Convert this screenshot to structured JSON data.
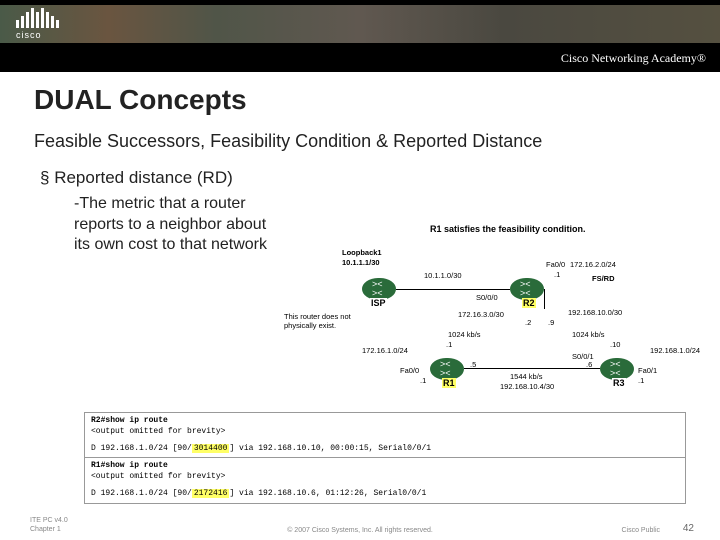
{
  "header": {
    "brand": "cisco",
    "academy": "Cisco Networking Academy®"
  },
  "slide": {
    "title": "DUAL Concepts",
    "subtitle": "Feasible Successors, Feasibility Condition & Reported Distance",
    "bullet": "Reported distance (RD)",
    "subbullet": "-The metric that a router reports to a neighbor about its own cost to that network"
  },
  "diagram": {
    "caption": "R1 satisfies the feasibility condition.",
    "loopback_title": "Loopback1",
    "loopback_ip": "10.1.1.1/30",
    "note": "This router does not physically exist.",
    "routers": {
      "isp": "ISP",
      "r1": "R1",
      "r2": "R2",
      "r3": "R3"
    },
    "nets": {
      "n1": "10.1.1.0/30",
      "n2": "172.16.1.0/24",
      "n3": "172.16.3.0/30",
      "n4": "172.16.2.0/24",
      "n5": "192.168.10.0/30",
      "n6": "192.168.10.4/30",
      "n7": "192.168.1.0/24"
    },
    "ports": {
      "fa00": "Fa0/0",
      "fa01": "Fa0/1",
      "s000": "S0/0/0",
      "s001": "S0/0/1"
    },
    "speeds": {
      "k1024": "1024 kb/s",
      "k1544": "1544 kb/s"
    },
    "dots": {
      "d1": ".1",
      "d2": ".2",
      "d5": ".5",
      "d6": ".6",
      "d9": ".9",
      "d10": ".10"
    },
    "fsrd": "FS/RD"
  },
  "code": {
    "r2_cmd": "R2#show ip route",
    "omit": "<output omitted for brevity>",
    "r2_line": "D    192.168.1.0/24 [90/",
    "r2_metric": "3014400",
    "r2_rest": "] via 192.168.10.10, 00:00:15, Serial0/0/1",
    "r1_cmd": "R1#show ip route",
    "r1_line": "D    192.168.1.0/24 [90/",
    "r1_metric": "2172416",
    "r1_rest": "] via 192.168.10.6, 01:12:26, Serial0/0/1"
  },
  "footer": {
    "left1": "ITE PC v4.0",
    "left2": "Chapter 1",
    "center": "© 2007 Cisco Systems, Inc. All rights reserved.",
    "right1": "Cisco Public",
    "right2": "42"
  }
}
